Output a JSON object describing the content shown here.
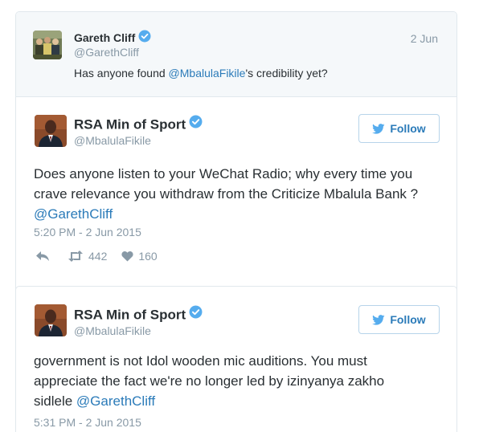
{
  "reply_context": {
    "name": "Gareth Cliff",
    "handle": "@GarethCliff",
    "date": "2 Jun",
    "text_before": "Has anyone found ",
    "mention": "@MbalulaFikile",
    "text_after": "'s credibility yet?"
  },
  "tweets": [
    {
      "name": "RSA Min of Sport",
      "handle": "@MbalulaFikile",
      "follow_label": "Follow",
      "line1": "Does anyone listen to your WeChat Radio; why every time you",
      "line2": "crave relevance you withdraw from the Criticize Mbalula Bank ?",
      "mention": "@GarethCliff",
      "timestamp": "5:20 PM - 2 Jun 2015",
      "retweets": "442",
      "likes": "160"
    },
    {
      "name": "RSA Min of Sport",
      "handle": "@MbalulaFikile",
      "follow_label": "Follow",
      "line1": "government is not Idol wooden mic auditions. You must",
      "line2": "appreciate the fact we're no longer led by izinyanya zakho",
      "line3_before": "sidlele ",
      "mention": "@GarethCliff",
      "timestamp": "5:31 PM - 2 Jun 2015"
    }
  ],
  "colors": {
    "link": "#2b7bb9",
    "muted": "#8899a6",
    "verified": "#55acee",
    "border": "#e1e8ed"
  },
  "icons": [
    "verified-badge-icon",
    "twitter-bird-icon",
    "reply-icon",
    "retweet-icon",
    "heart-icon"
  ]
}
